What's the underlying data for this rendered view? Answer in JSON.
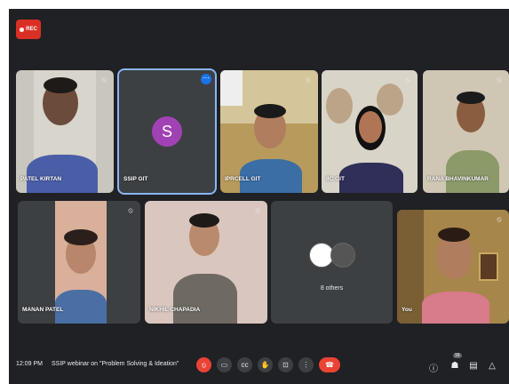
{
  "recording": {
    "label": "REC",
    "color": "#d93025"
  },
  "participants": [
    {
      "name": "PATEL KIRTAN",
      "muted": true
    },
    {
      "name": "SSIP GIT",
      "initial": "S",
      "avatar_color": "#a142b4",
      "active": true
    },
    {
      "name": "IPRCELL GIT",
      "muted": true
    },
    {
      "name": "IIC GIT",
      "muted": true
    },
    {
      "name": "RANA BHAVINKUMAR",
      "muted": true
    },
    {
      "name": "MANAN PATEL",
      "muted": true
    },
    {
      "name": "NIKHIL CHAPADIA",
      "muted": true
    },
    {
      "name": "8 others"
    },
    {
      "name": "You",
      "muted": true
    }
  ],
  "bottom_bar": {
    "time": "12:09 PM",
    "meeting_title": "SSIP webinar on \"Problem Solving & Ideation\"",
    "controls": [
      "mic-off-icon",
      "camera-icon",
      "captions-icon",
      "raise-hand-icon",
      "present-icon",
      "more-options-icon",
      "end-call-icon"
    ],
    "right_icons": [
      "info-icon",
      "people-icon",
      "chat-icon",
      "activities-icon"
    ],
    "people_count": "16"
  }
}
